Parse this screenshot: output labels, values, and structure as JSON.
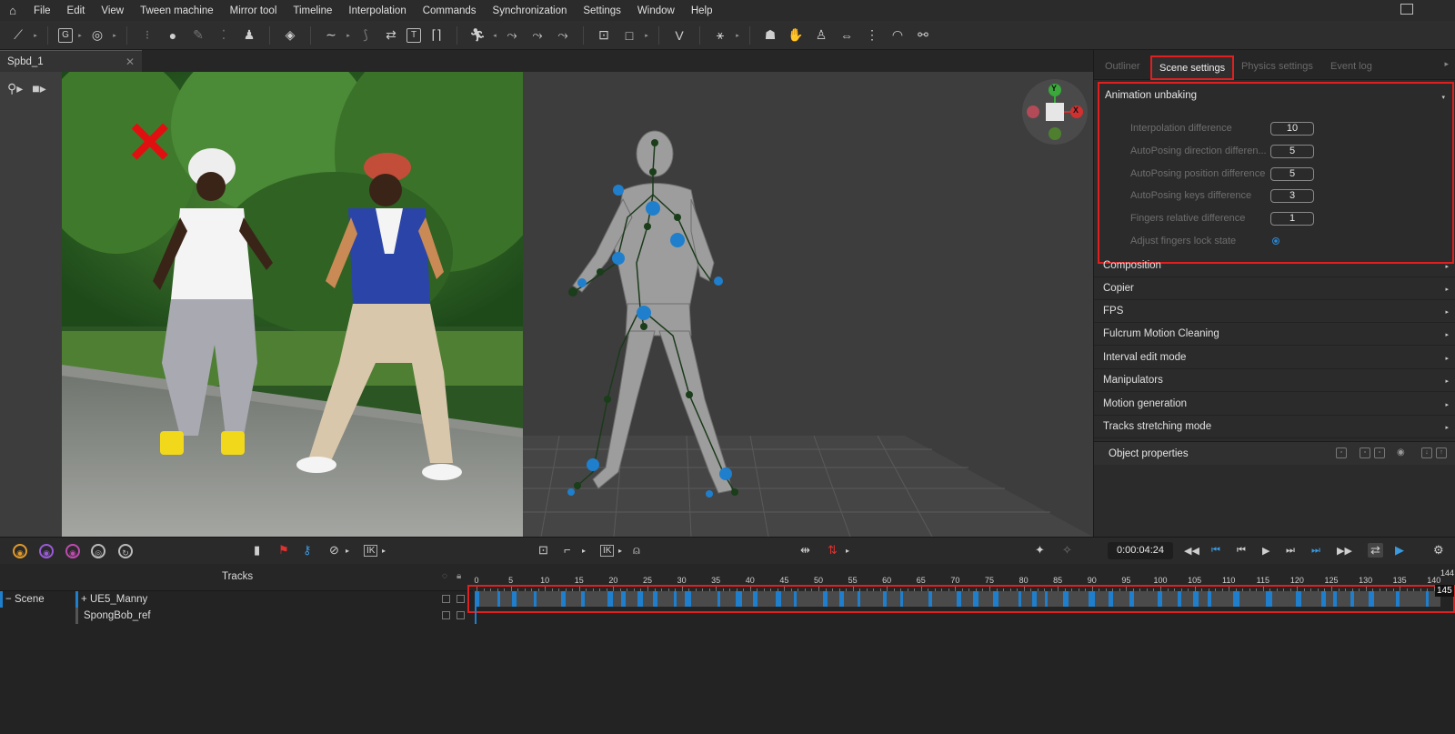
{
  "menu": {
    "items": [
      "File",
      "Edit",
      "View",
      "Tween machine",
      "Mirror tool",
      "Timeline",
      "Interpolation",
      "Commands",
      "Synchronization",
      "Settings",
      "Window",
      "Help"
    ]
  },
  "document_tab": {
    "label": "Spbd_1"
  },
  "right_panel": {
    "tabs": [
      "Outliner",
      "Scene settings",
      "Physics settings",
      "Event log"
    ],
    "active_tab": "Scene settings",
    "animation_unbaking": {
      "title": "Animation unbaking",
      "properties": [
        {
          "label": "Interpolation difference",
          "value": "10"
        },
        {
          "label": "AutoPosing direction differen...",
          "value": "5"
        },
        {
          "label": "AutoPosing position difference",
          "value": "5"
        },
        {
          "label": "AutoPosing keys difference",
          "value": "3"
        },
        {
          "label": "Fingers relative difference",
          "value": "1"
        }
      ],
      "toggle_label": "Adjust fingers lock state"
    },
    "sections": [
      "Composition",
      "Copier",
      "FPS",
      "Fulcrum Motion Cleaning",
      "Interval edit mode",
      "Manipulators",
      "Motion generation",
      "Tracks stretching mode"
    ],
    "object_properties": "Object properties"
  },
  "timeline": {
    "timecode": "0:00:04:24",
    "tracks_header": "Tracks",
    "scene_label": "Scene",
    "tracks": [
      "UE5_Manny",
      "SpongBob_ref"
    ],
    "ruler_labels": [
      "0",
      "5",
      "10",
      "15",
      "20",
      "25",
      "30",
      "35",
      "40",
      "45",
      "50",
      "55",
      "60",
      "65",
      "70",
      "75",
      "80",
      "85",
      "90",
      "95",
      "100",
      "105",
      "110",
      "115",
      "120",
      "125",
      "130",
      "135",
      "140"
    ],
    "end_frame": "145",
    "end_frame_top": "144"
  },
  "gizmo": {
    "y_label": "Y",
    "x_label": "X"
  },
  "colors": {
    "accent_blue": "#1f7fcc",
    "highlight_red": "#e02020",
    "bg": "#232323"
  }
}
